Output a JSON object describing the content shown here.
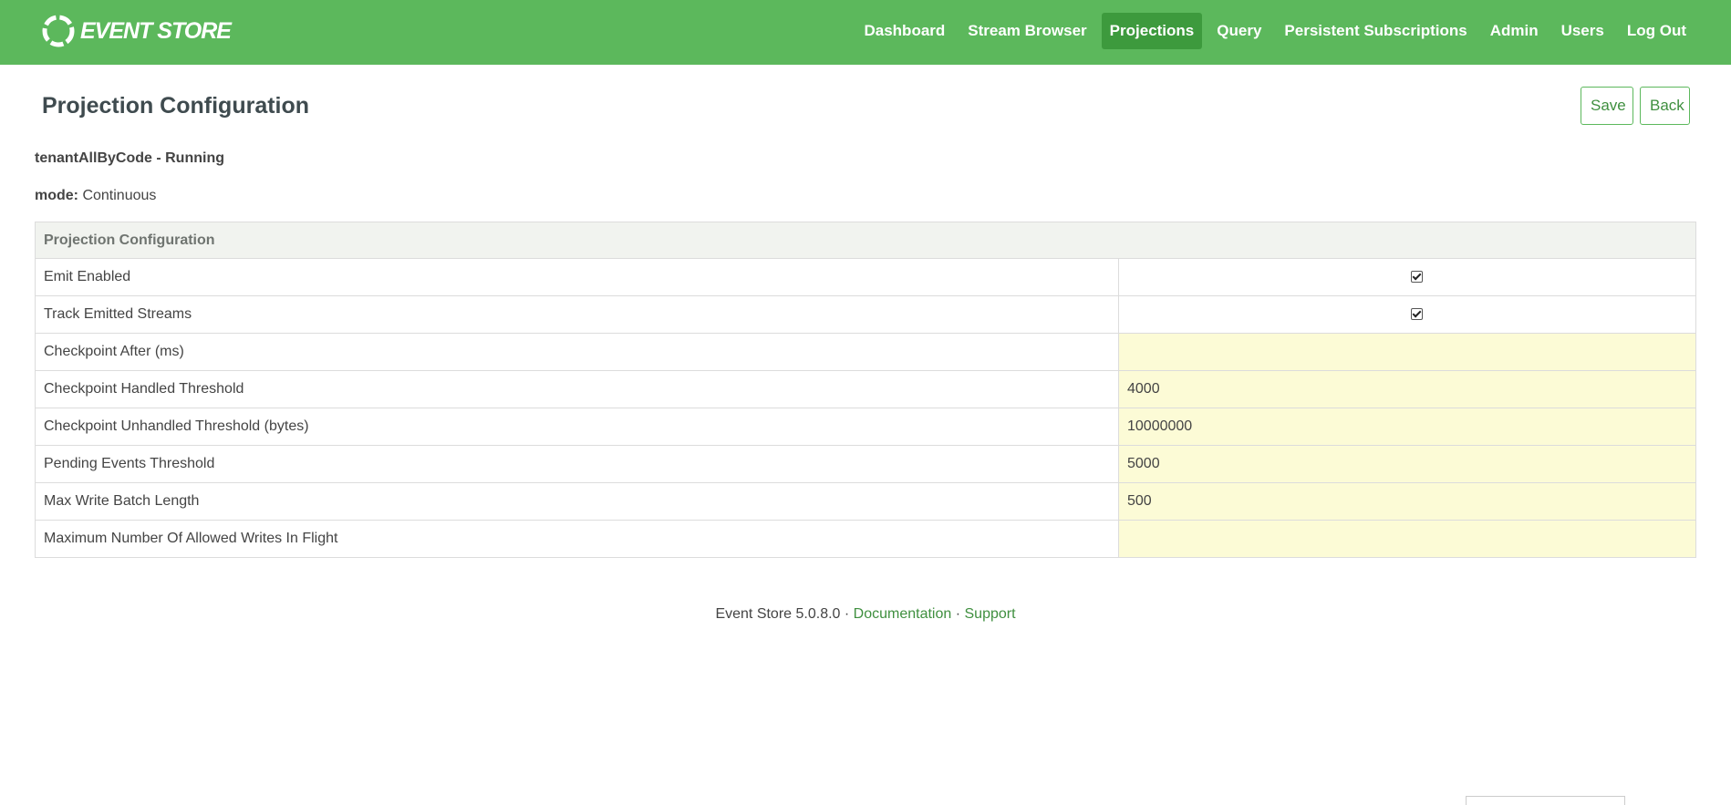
{
  "brand": {
    "name": "EVENT STORE"
  },
  "nav": {
    "items": [
      "Dashboard",
      "Stream Browser",
      "Projections",
      "Query",
      "Persistent Subscriptions",
      "Admin",
      "Users",
      "Log Out"
    ],
    "active": "Projections"
  },
  "page": {
    "title": "Projection Configuration",
    "save_label": "Save",
    "back_label": "Back",
    "projection_status": "tenantAllByCode - Running",
    "mode_label": "mode:",
    "mode_value": "Continuous"
  },
  "config_table": {
    "header": "Projection Configuration",
    "rows": [
      {
        "label": "Emit Enabled",
        "type": "checkbox",
        "checked": true
      },
      {
        "label": "Track Emitted Streams",
        "type": "checkbox",
        "checked": true
      },
      {
        "label": "Checkpoint After (ms)",
        "type": "input",
        "value": ""
      },
      {
        "label": "Checkpoint Handled Threshold",
        "type": "input",
        "value": "4000"
      },
      {
        "label": "Checkpoint Unhandled Threshold (bytes)",
        "type": "input",
        "value": "10000000"
      },
      {
        "label": "Pending Events Threshold",
        "type": "input",
        "value": "5000"
      },
      {
        "label": "Max Write Batch Length",
        "type": "input",
        "value": "500"
      },
      {
        "label": "Maximum Number Of Allowed Writes In Flight",
        "type": "input",
        "value": ""
      }
    ]
  },
  "footer": {
    "version": "Event Store 5.0.8.0",
    "separator": " · ",
    "documentation": "Documentation",
    "support": "Support"
  },
  "colors": {
    "brand_green": "#5cb85c",
    "active_green": "#3d9a3d",
    "input_bg": "#fcfbd6"
  }
}
